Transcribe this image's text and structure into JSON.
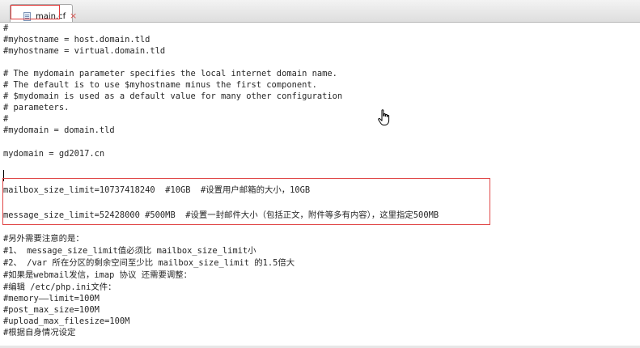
{
  "tab": {
    "label": "main.cf",
    "close": "×"
  },
  "editor": {
    "lines": [
      "#",
      "#myhostname = host.domain.tld",
      "#myhostname = virtual.domain.tld",
      "",
      "# The mydomain parameter specifies the local internet domain name.",
      "# The default is to use $myhostname minus the first component.",
      "# $mydomain is used as a default value for many other configuration",
      "# parameters.",
      "#",
      "#mydomain = domain.tld",
      "",
      "mydomain = gd2017.cn",
      "",
      "",
      "mailbox_size_limit=10737418240  #10GB  #设置用户邮箱的大小，10GB",
      "",
      "message_size_limit=52428000 #500MB  #设置一封邮件大小（包括正文，附件等多有内容），这里指定500MB",
      "",
      "#另外需要注意的是：",
      "#1、 message_size_limit值必须比 mailbox_size_limit小",
      "#2、 /var 所在分区的剩余空间至少比 mailbox_size_limit 的1.5倍大",
      "#如果是webmail发信，imap 协议 还需要调整：",
      "#编辑 /etc/php.ini文件：",
      "#memory——limit=100M",
      "#post_max_size=100M",
      "#upload_max_filesize=100M",
      "#根据自身情况设定"
    ]
  },
  "icons": {
    "file": "document-icon",
    "pointer": "hand-pointer-icon"
  },
  "colors": {
    "highlight": "#e04848",
    "text": "#262626"
  }
}
